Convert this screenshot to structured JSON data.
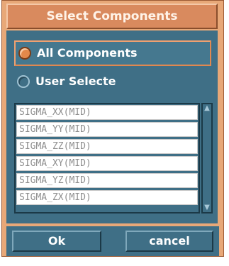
{
  "dialog": {
    "title": "Select Components"
  },
  "selection": {
    "options": [
      {
        "label": "All Components",
        "selected": true
      },
      {
        "label": "User Selecte",
        "selected": false
      }
    ]
  },
  "components": {
    "items": [
      "SIGMA_XX(MID)",
      "SIGMA_YY(MID)",
      "SIGMA_ZZ(MID)",
      "SIGMA_XY(MID)",
      "SIGMA_YZ(MID)",
      "SIGMA_ZX(MID)"
    ]
  },
  "buttons": {
    "ok_label": "Ok",
    "cancel_label": "cancel"
  },
  "icons": {
    "scroll_up": "triangle-up-icon",
    "scroll_down": "triangle-down-icon"
  },
  "colors": {
    "title_bg": "#d98a5e",
    "panel_bg": "#3f6f86",
    "accent": "#e3884a"
  }
}
